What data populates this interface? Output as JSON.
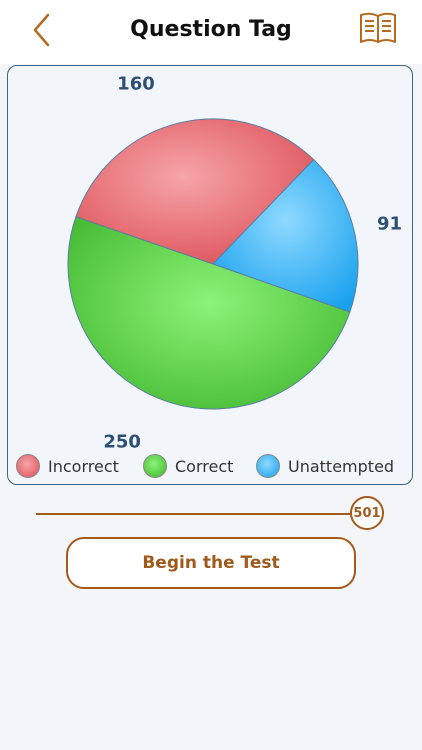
{
  "header": {
    "title": "Question Tag",
    "back_icon": "chevron-left-icon",
    "book_icon": "book-icon",
    "accent_color": "#b56a22"
  },
  "chart_data": {
    "type": "pie",
    "slices": [
      {
        "label": "Incorrect",
        "value": 160,
        "color": "#e8696e"
      },
      {
        "label": "Correct",
        "value": 250,
        "color": "#4fc83a"
      },
      {
        "label": "Unattempted",
        "value": 91,
        "color": "#2cb4f8"
      }
    ],
    "legend_position": "bottom"
  },
  "legend": {
    "items": [
      {
        "label": "Incorrect",
        "color": "#e8696e"
      },
      {
        "label": "Correct",
        "color": "#4fc83a"
      },
      {
        "label": "Unattempted",
        "color": "#2cb4f8"
      }
    ]
  },
  "slider": {
    "value": "501",
    "max": 501
  },
  "begin_button": {
    "label": "Begin the Test"
  }
}
